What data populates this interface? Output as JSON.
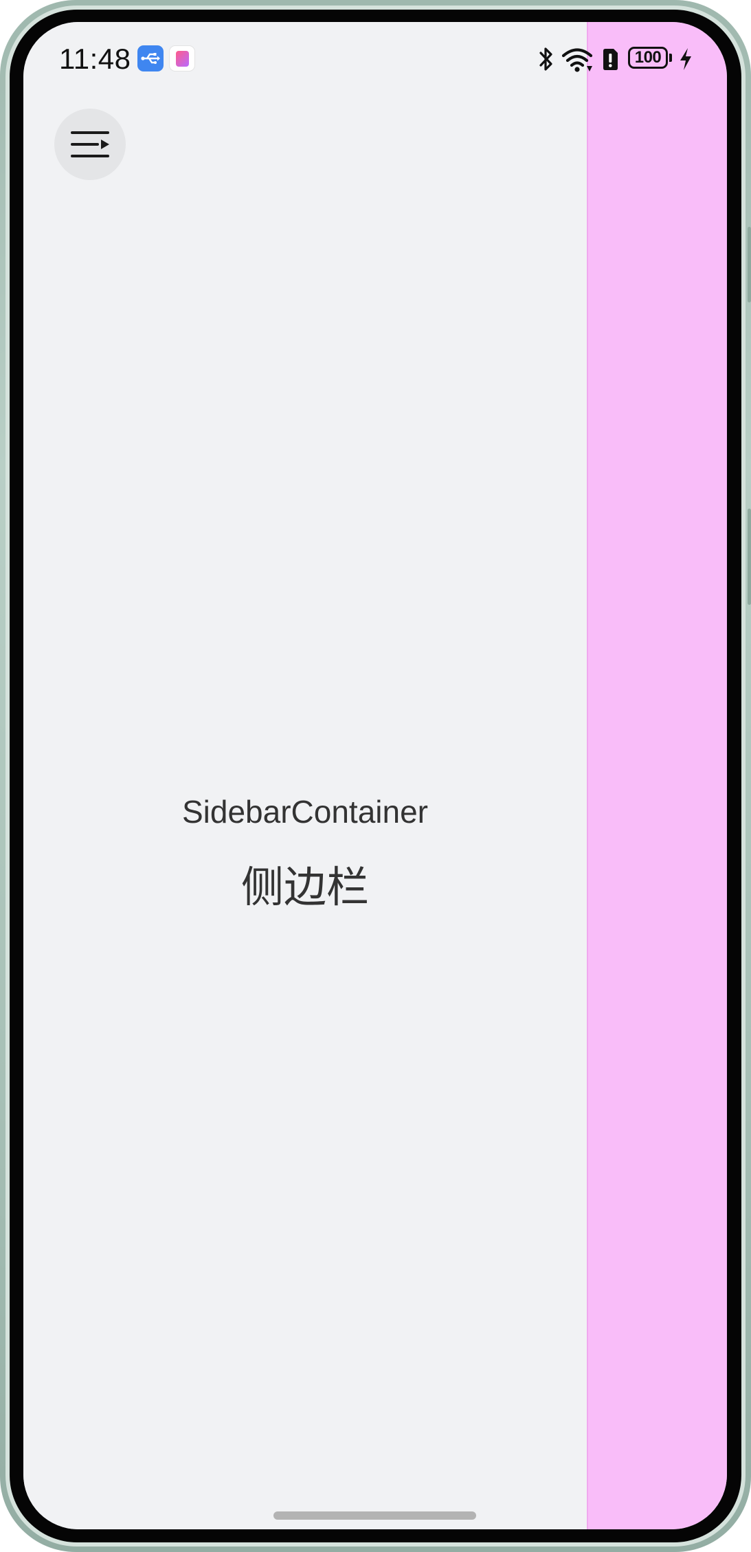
{
  "status_bar": {
    "time": "11:48",
    "battery_level": "100",
    "notification_icons": [
      "usb-icon",
      "app-notification-icon"
    ],
    "system_icons": [
      "bluetooth-icon",
      "wifi-icon",
      "alert-icon",
      "battery-icon",
      "charging-icon"
    ]
  },
  "toolbar": {
    "sidebar_toggle_icon": "sidebar-toggle-icon"
  },
  "main": {
    "title_en": "SidebarContainer",
    "title_zh": "侧边栏"
  },
  "colors": {
    "content_background": "#f1f2f4",
    "sidebar_background": "#f9bdf9",
    "toggle_background": "#e4e5e7",
    "text": "#333333"
  }
}
